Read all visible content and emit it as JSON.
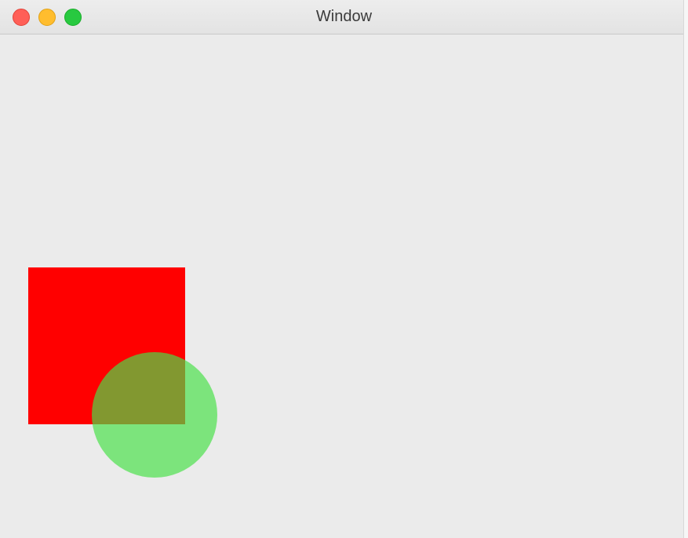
{
  "window": {
    "title": "Window"
  },
  "shapes": {
    "square": {
      "color": "#ff0000"
    },
    "circle": {
      "color": "rgba(71,224,71,0.68)"
    }
  }
}
